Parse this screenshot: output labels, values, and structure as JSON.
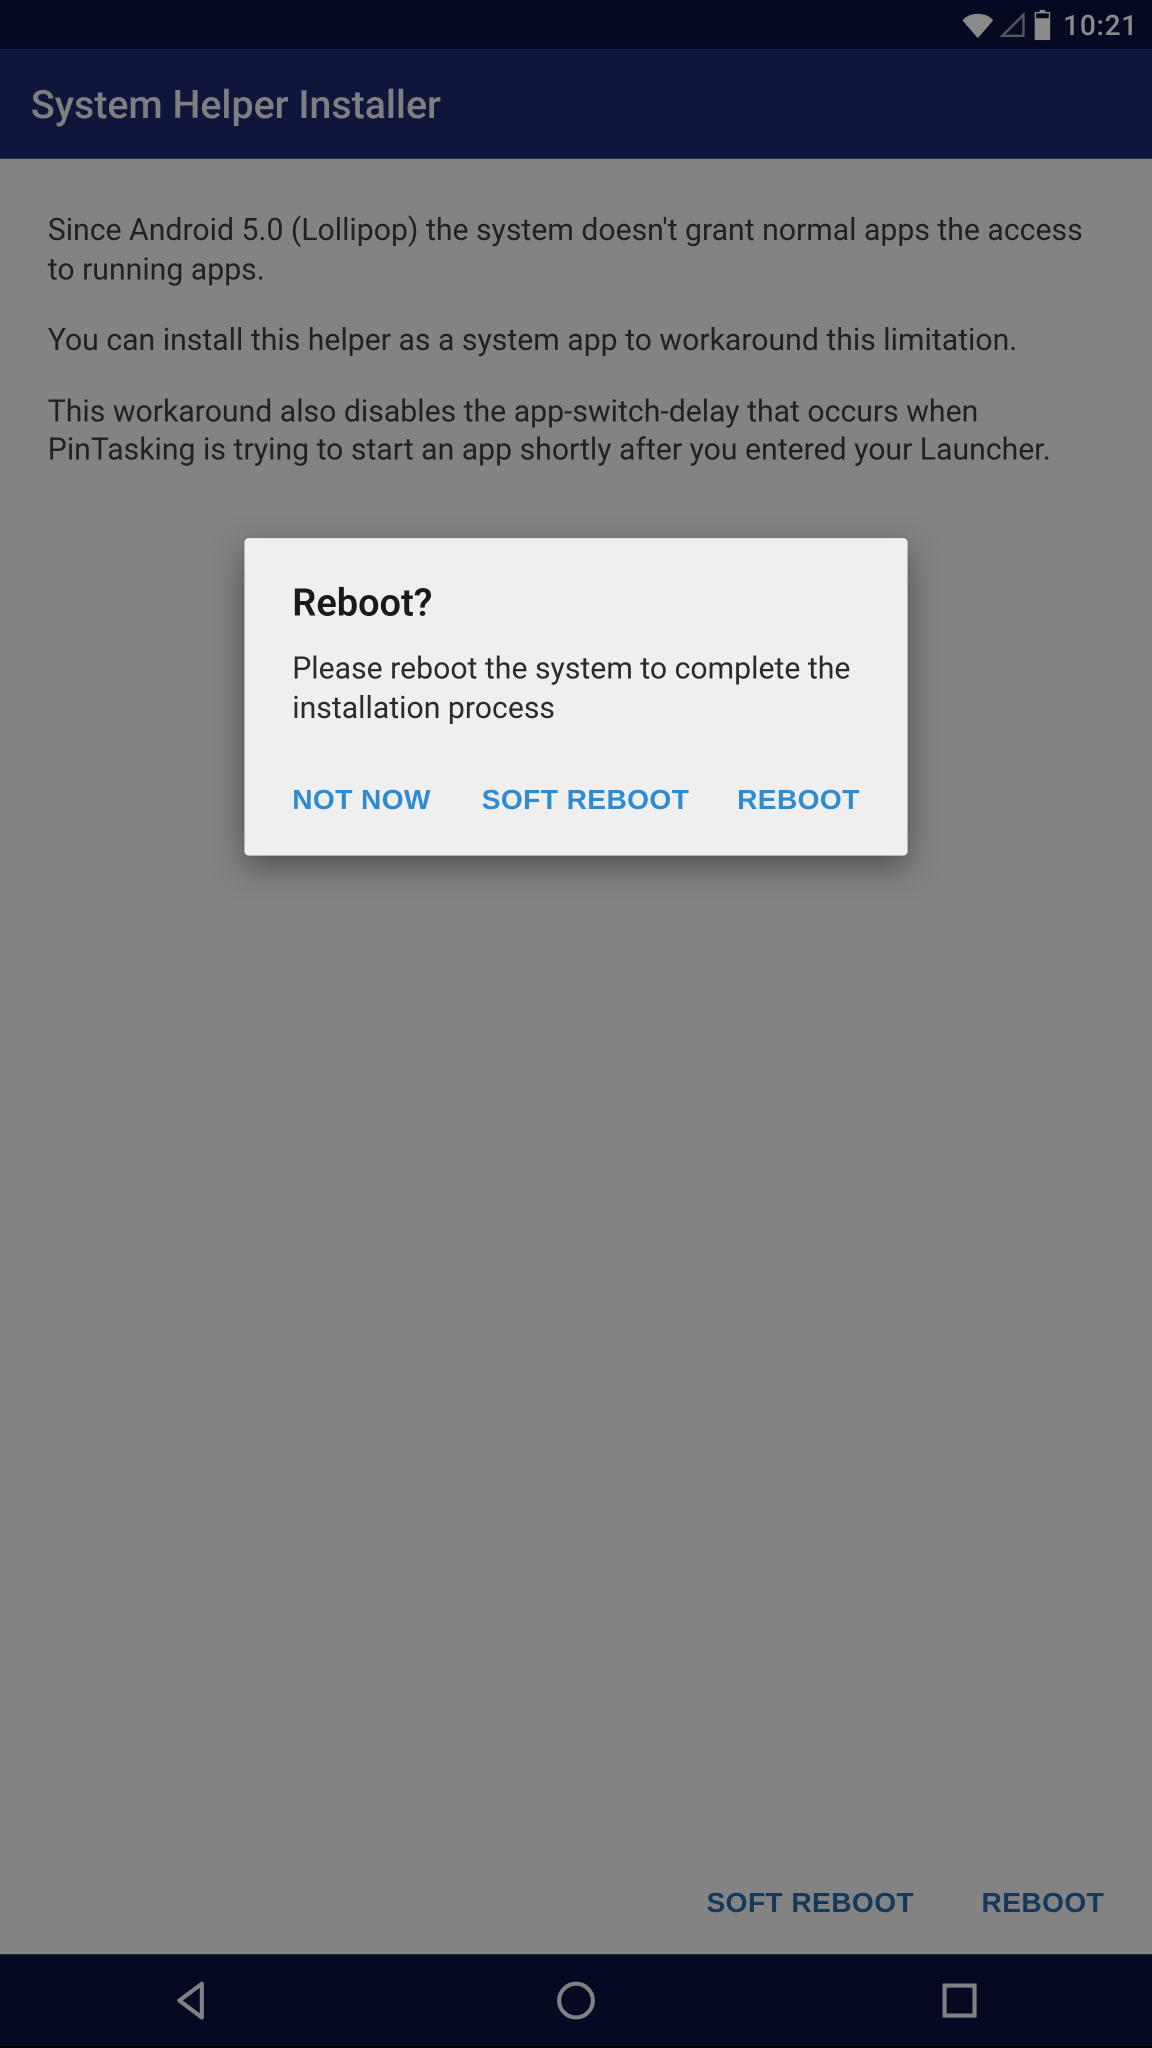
{
  "status_bar": {
    "time": "10:21"
  },
  "app_bar": {
    "title": "System Helper Installer"
  },
  "content": {
    "paragraph1": "Since Android 5.0 (Lollipop) the system doesn't grant normal apps the access to running apps.",
    "paragraph2": "You can install this helper as a system app to workaround this limitation.",
    "paragraph3": "This workaround also disables the app-switch-delay that occurs when PinTasking is trying to start an app shortly after you entered your Launcher."
  },
  "bottom_buttons": {
    "soft_reboot": "SOFT REBOOT",
    "reboot": "REBOOT"
  },
  "dialog": {
    "title": "Reboot?",
    "message": "Please reboot the system to complete the installation process",
    "actions": {
      "not_now": "NOT NOW",
      "soft_reboot": "SOFT REBOOT",
      "reboot": "REBOOT"
    }
  }
}
